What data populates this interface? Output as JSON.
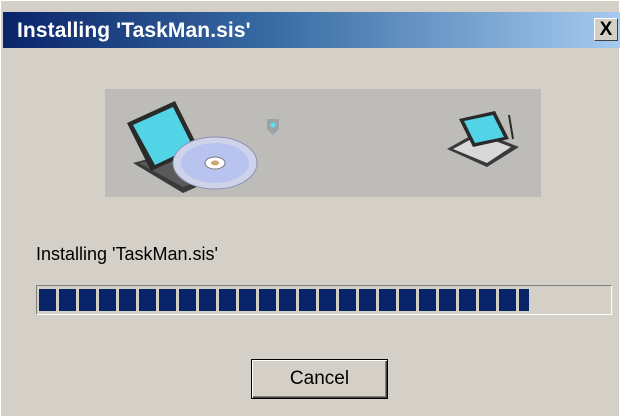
{
  "window": {
    "title": "Installing 'TaskMan.sis'",
    "close_label": "X"
  },
  "banner": {
    "icons": [
      "laptop-with-cd-icon",
      "transfer-arrow-icon",
      "handheld-device-icon"
    ]
  },
  "status_text": "Installing 'TaskMan.sis'",
  "progress": {
    "value": 0.86
  },
  "buttons": {
    "cancel_label": "Cancel"
  },
  "colors": {
    "title_start": "#0a246a",
    "title_end": "#a6caf0",
    "progress_fill": "#0a246a",
    "window_bg": "#d4d0c8"
  }
}
